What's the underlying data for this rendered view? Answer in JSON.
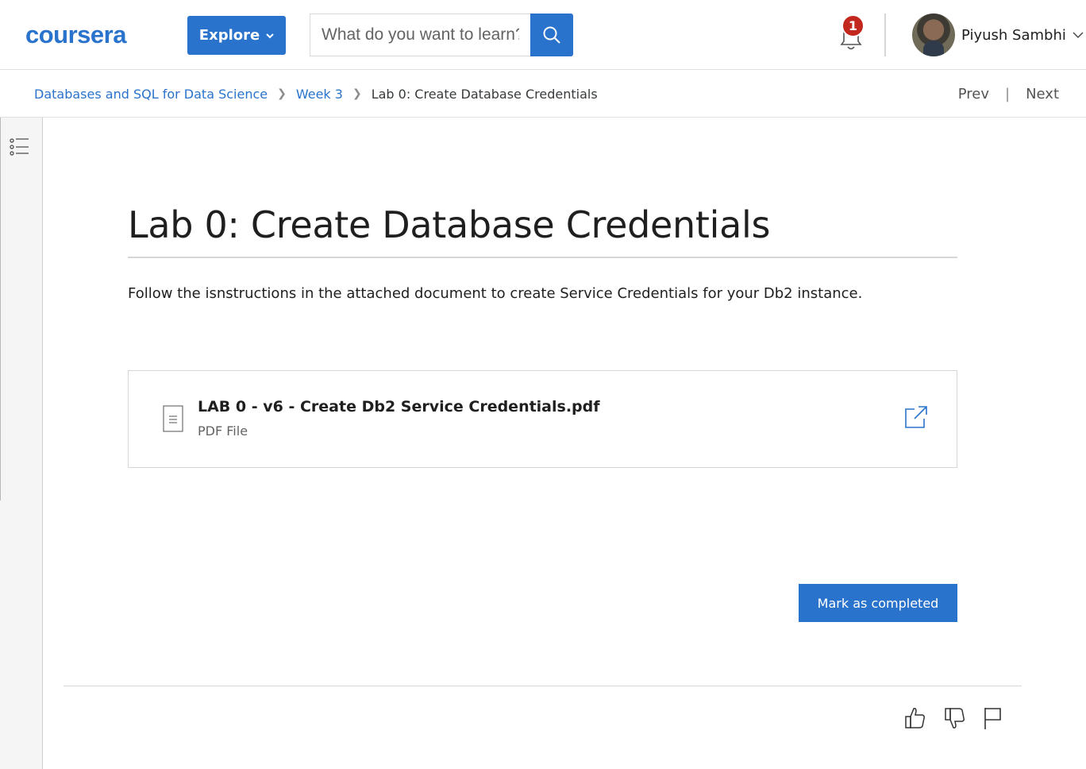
{
  "header": {
    "logo": "coursera",
    "explore_label": "Explore",
    "search_placeholder": "What do you want to learn?",
    "notification_count": "1",
    "user_name": "Piyush Sambhi"
  },
  "breadcrumb": {
    "items": [
      "Databases and SQL for Data Science",
      "Week 3"
    ],
    "current": "Lab 0: Create Database Credentials",
    "prev_label": "Prev",
    "next_label": "Next",
    "separator": "|"
  },
  "main": {
    "title": "Lab 0: Create Database Credentials",
    "description": "Follow the isnstructions in the attached document to create Service Credentials for your Db2 instance.",
    "file": {
      "name": "LAB 0 - v6 - Create Db2 Service Credentials.pdf",
      "type": "PDF File"
    },
    "complete_label": "Mark as completed"
  },
  "colors": {
    "brand": "#2a73cc",
    "badge": "#c3281e"
  },
  "icons": {
    "explore": "chevron-down-icon",
    "search": "search-icon",
    "notifications": "bell-icon",
    "user_menu": "chevron-down-icon",
    "toc": "list-icon",
    "file": "document-icon",
    "open": "external-link-icon",
    "like": "thumbs-up-icon",
    "dislike": "thumbs-down-icon",
    "report": "flag-icon"
  }
}
